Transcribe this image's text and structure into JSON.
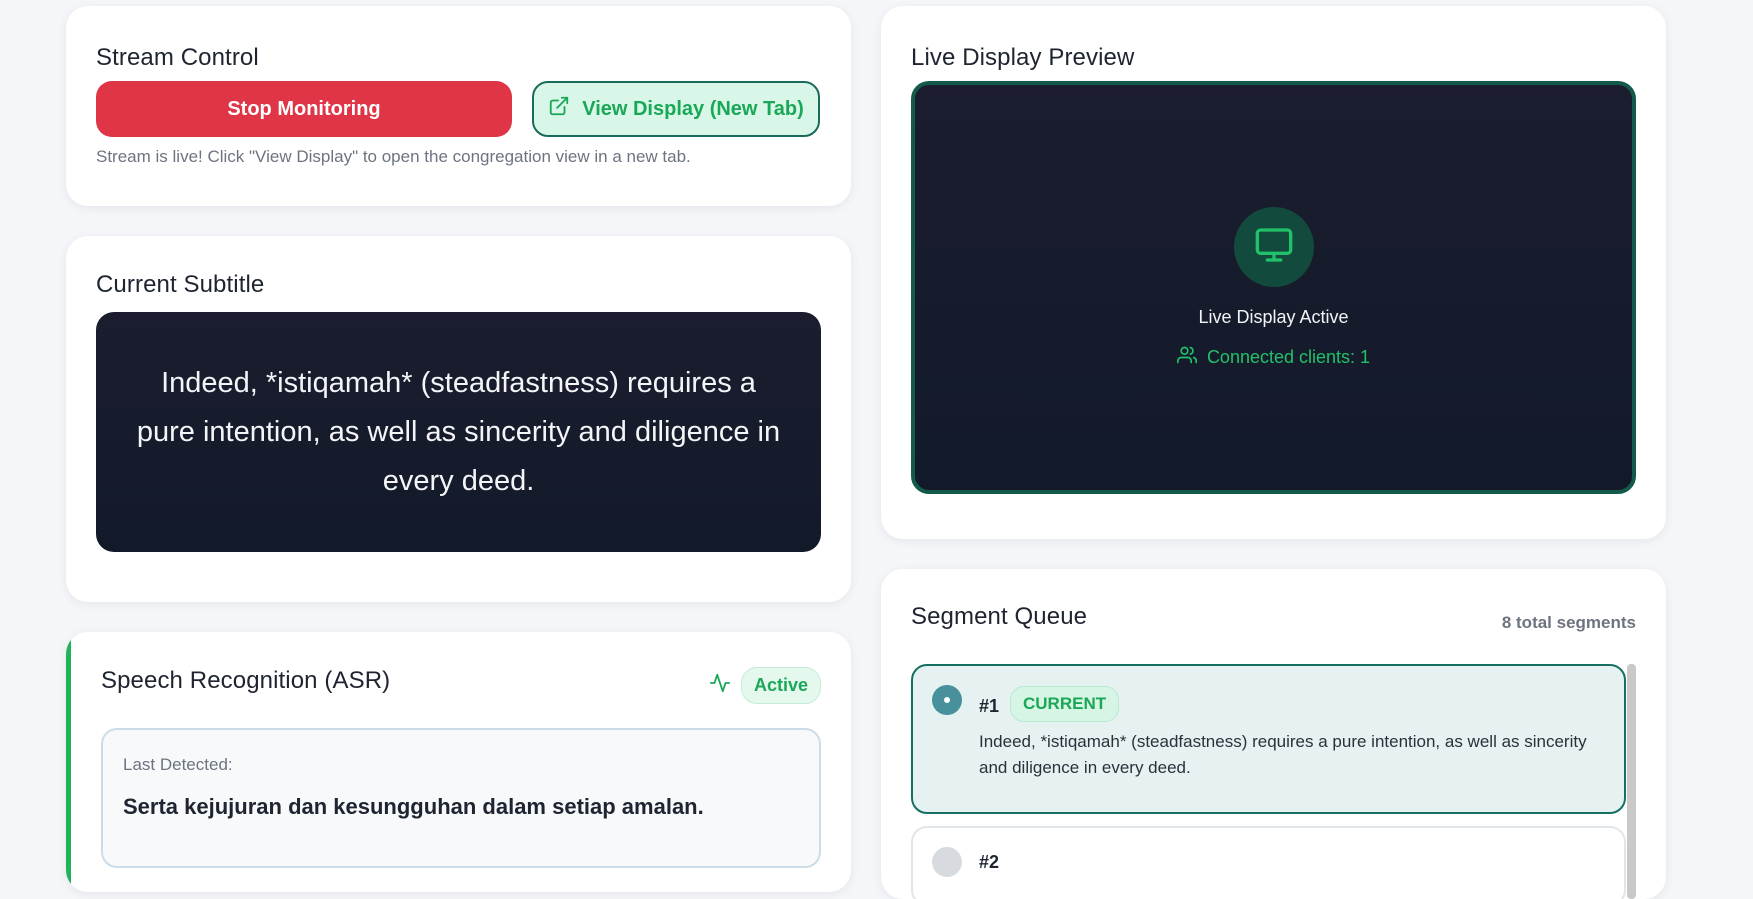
{
  "stream_control": {
    "title": "Stream Control",
    "stop_label": "Stop Monitoring",
    "view_label": "View Display (New Tab)",
    "helper": "Stream is live! Click \"View Display\" to open the congregation view in a new tab."
  },
  "current_subtitle": {
    "title": "Current Subtitle",
    "text": "Indeed, *istiqamah* (steadfastness) requires a pure intention, as well as sincerity and diligence in every deed."
  },
  "asr": {
    "title": "Speech Recognition (ASR)",
    "status": "Active",
    "last_label": "Last Detected:",
    "last_text": "Serta kejujuran dan kesungguhan dalam setiap amalan."
  },
  "preview": {
    "title": "Live Display Preview",
    "status": "Live Display Active",
    "clients": "Connected clients: 1"
  },
  "queue": {
    "title": "Segment Queue",
    "count": "8 total segments",
    "segments": [
      {
        "number": "#1",
        "badge": "CURRENT",
        "text": "Indeed, *istiqamah* (steadfastness) requires a pure intention, as well as sincerity and diligence in every deed."
      },
      {
        "number": "#2"
      }
    ]
  },
  "colors": {
    "danger": "#df3546",
    "success": "#1aa757",
    "teal": "#167062",
    "dark_panel": "#121a2a"
  },
  "icons": [
    "external-link-icon",
    "activity-icon",
    "monitor-icon",
    "users-icon"
  ]
}
